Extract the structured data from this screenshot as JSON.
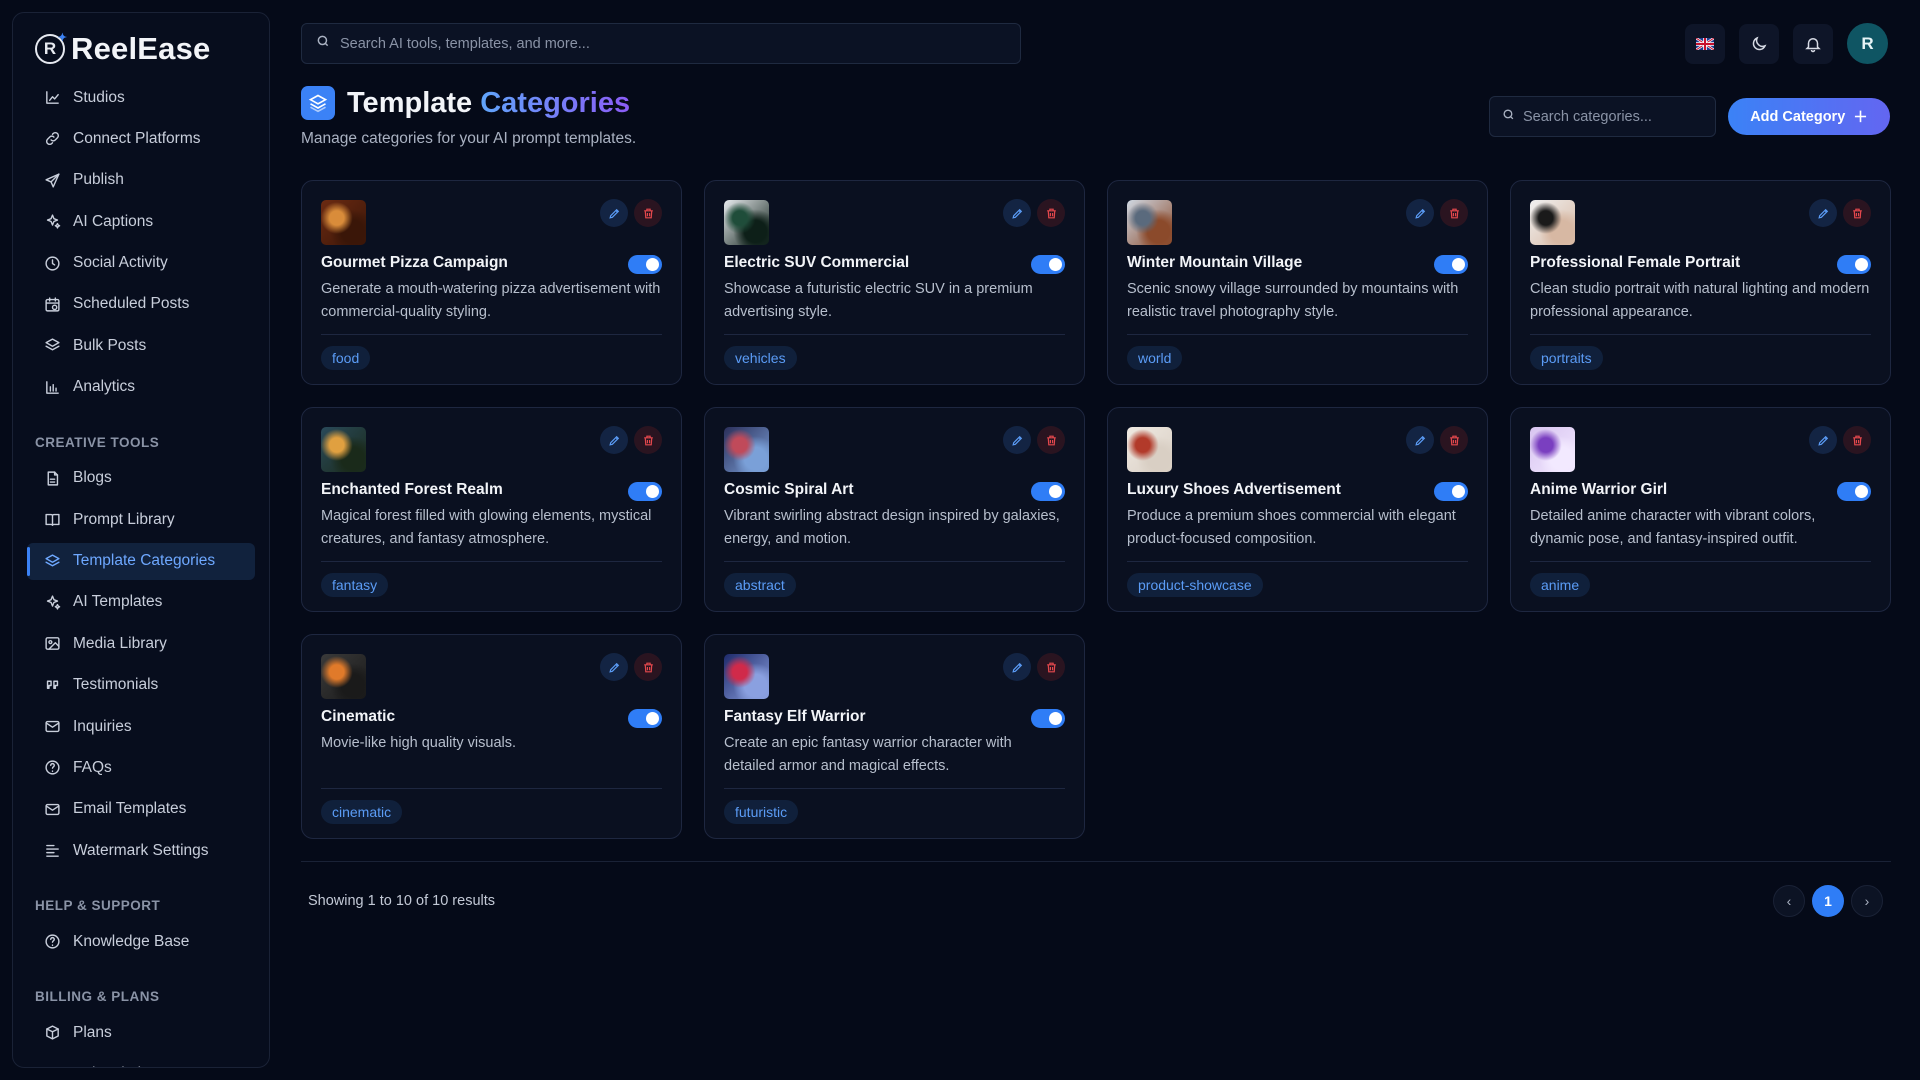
{
  "brand": {
    "name": "ReelEase",
    "mark": "R"
  },
  "sidebar": {
    "main": [
      {
        "label": "Studios",
        "icon": "studio-icon"
      },
      {
        "label": "Connect Platforms",
        "icon": "link-icon"
      },
      {
        "label": "Publish",
        "icon": "send-icon"
      },
      {
        "label": "AI Captions",
        "icon": "sparkles-icon"
      },
      {
        "label": "Social Activity",
        "icon": "clock-icon"
      },
      {
        "label": "Scheduled Posts",
        "icon": "calendar-clock-icon"
      },
      {
        "label": "Bulk Posts",
        "icon": "layers-icon"
      },
      {
        "label": "Analytics",
        "icon": "bar-chart-icon"
      }
    ],
    "creative_label": "CREATIVE TOOLS",
    "creative": [
      {
        "label": "Blogs",
        "icon": "file-icon"
      },
      {
        "label": "Prompt Library",
        "icon": "book-icon"
      },
      {
        "label": "Template Categories",
        "icon": "layers-icon",
        "active": true
      },
      {
        "label": "AI Templates",
        "icon": "sparkles-icon"
      },
      {
        "label": "Media Library",
        "icon": "image-icon"
      },
      {
        "label": "Testimonials",
        "icon": "quote-icon"
      },
      {
        "label": "Inquiries",
        "icon": "mail-icon"
      },
      {
        "label": "FAQs",
        "icon": "help-circle-icon"
      },
      {
        "label": "Email Templates",
        "icon": "mail-icon"
      },
      {
        "label": "Watermark Settings",
        "icon": "watermark-icon"
      }
    ],
    "help_label": "HELP & SUPPORT",
    "help": [
      {
        "label": "Knowledge Base",
        "icon": "help-circle-icon"
      }
    ],
    "billing_label": "BILLING & PLANS",
    "billing": [
      {
        "label": "Plans",
        "icon": "package-icon"
      },
      {
        "label": "Subscriptions",
        "icon": "ticket-icon"
      }
    ]
  },
  "topbar": {
    "search_placeholder": "Search AI tools, templates, and more...",
    "avatar_initial": "R"
  },
  "page": {
    "title_main": "Template",
    "title_accent": "Categories",
    "subtitle": "Manage categories for your AI prompt templates.",
    "search_placeholder": "Search categories...",
    "add_label": "Add Category"
  },
  "cards": [
    {
      "title": "Gourmet Pizza Campaign",
      "desc": "Generate a mouth-watering pizza advertisement with commercial-quality styling.",
      "tag": "food",
      "enabled": true,
      "colors": [
        "#6b2a12",
        "#d98c3a",
        "#3a1608"
      ]
    },
    {
      "title": "Electric SUV Commercial",
      "desc": "Showcase a futuristic electric SUV in a premium advertising style.",
      "tag": "vehicles",
      "enabled": true,
      "colors": [
        "#e9ecef",
        "#1f4d3a",
        "#0d1f18"
      ]
    },
    {
      "title": "Winter Mountain Village",
      "desc": "Scenic snowy village surrounded by mountains with realistic travel photography style.",
      "tag": "world",
      "enabled": true,
      "colors": [
        "#cfd8e3",
        "#5a6a7d",
        "#8b4a2b"
      ]
    },
    {
      "title": "Professional Female Portrait",
      "desc": "Clean studio portrait with natural lighting and modern professional appearance.",
      "tag": "portraits",
      "enabled": true,
      "colors": [
        "#f1f1f1",
        "#1a1a1a",
        "#d7b8a3"
      ]
    },
    {
      "title": "Enchanted Forest Realm",
      "desc": "Magical forest filled with glowing elements, mystical creatures, and fantasy atmosphere.",
      "tag": "fantasy",
      "enabled": true,
      "colors": [
        "#2a4a5a",
        "#e0a040",
        "#1a2a1a"
      ]
    },
    {
      "title": "Cosmic Spiral Art",
      "desc": "Vibrant swirling abstract design inspired by galaxies, energy, and motion.",
      "tag": "abstract",
      "enabled": true,
      "colors": [
        "#2b2f5a",
        "#c04a5a",
        "#7aa0d8"
      ]
    },
    {
      "title": "Luxury Shoes Advertisement",
      "desc": "Produce a premium shoes commercial with elegant product-focused composition.",
      "tag": "product-showcase",
      "enabled": true,
      "colors": [
        "#efe9e2",
        "#b23a2a",
        "#d9cfc4"
      ]
    },
    {
      "title": "Anime Warrior Girl",
      "desc": "Detailed anime character with vibrant colors, dynamic pose, and fantasy-inspired outfit.",
      "tag": "anime",
      "enabled": true,
      "colors": [
        "#d8c4f0",
        "#7a3fc0",
        "#f2e9ff"
      ]
    },
    {
      "title": "Cinematic",
      "desc": "Movie-like high quality visuals.",
      "tag": "cinematic",
      "enabled": true,
      "colors": [
        "#3a3a3a",
        "#e07a2a",
        "#1a1a1a"
      ]
    },
    {
      "title": "Fantasy Elf Warrior",
      "desc": "Create an epic fantasy warrior character with detailed armor and magical effects.",
      "tag": "futuristic",
      "enabled": true,
      "colors": [
        "#1e2a6a",
        "#d02a4a",
        "#8aa0e0"
      ]
    }
  ],
  "pagination": {
    "summary": "Showing 1 to 10 of 10 results",
    "current": "1",
    "prev": "‹",
    "next": "›"
  }
}
